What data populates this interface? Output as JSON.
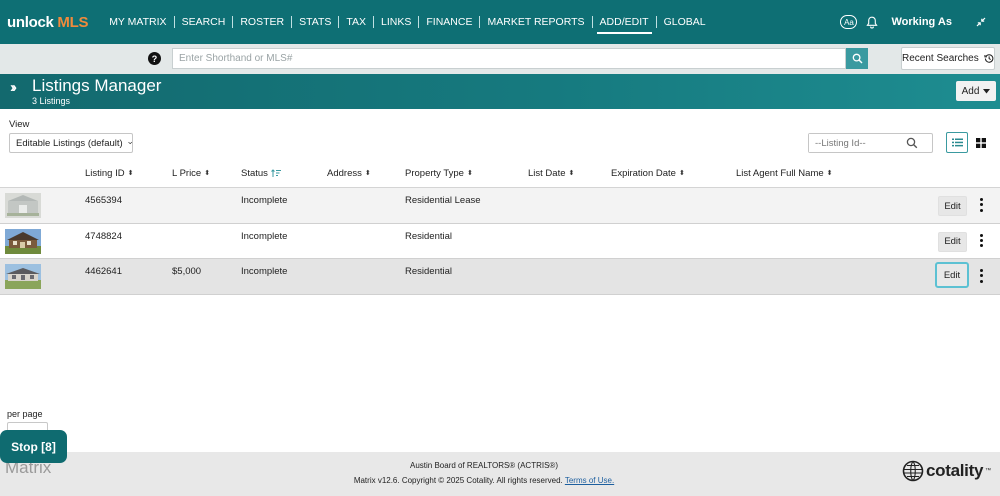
{
  "topnav": {
    "logo_primary": "unlock",
    "logo_accent": "MLS",
    "menu": [
      "MY MATRIX",
      "SEARCH",
      "ROSTER",
      "STATS",
      "TAX",
      "LINKS",
      "FINANCE",
      "MARKET REPORTS",
      "ADD/EDIT",
      "GLOBAL"
    ],
    "active_menu": "ADD/EDIT",
    "font_button": "Aa",
    "working_as": "Working As"
  },
  "searchbar": {
    "placeholder": "Enter Shorthand or MLS#",
    "recent_label": "Recent Searches"
  },
  "header": {
    "title": "Listings Manager",
    "subtitle": "3 Listings",
    "add_label": "Add"
  },
  "view": {
    "label": "View",
    "selected": "Editable Listings (default)",
    "listing_search_placeholder": "--Listing Id--"
  },
  "table": {
    "columns": [
      "Listing ID",
      "L Price",
      "Status",
      "Address",
      "Property Type",
      "List Date",
      "Expiration Date",
      "List Agent Full Name"
    ],
    "rows": [
      {
        "listing_id": "4565394",
        "price": "",
        "status": "Incomplete",
        "address": "",
        "property_type": "Residential Lease",
        "list_date": "",
        "expiration_date": "",
        "agent": "",
        "edit_label": "Edit"
      },
      {
        "listing_id": "4748824",
        "price": "",
        "status": "Incomplete",
        "address": "",
        "property_type": "Residential",
        "list_date": "",
        "expiration_date": "",
        "agent": "",
        "edit_label": "Edit"
      },
      {
        "listing_id": "4462641",
        "price": "$5,000",
        "status": "Incomplete",
        "address": "",
        "property_type": "Residential",
        "list_date": "",
        "expiration_date": "",
        "agent": "",
        "edit_label": "Edit"
      }
    ]
  },
  "pagination": {
    "per_page_label": "per page"
  },
  "stop_button": "Stop [8]",
  "footer": {
    "matrix_logo": "Matrix",
    "board": "Austin Board of REALTORS® (ACTRIS®)",
    "copyright": "Matrix v12.6. Copyright © 2025 Cotality. All rights reserved.",
    "terms_link": "Terms of Use.",
    "cotality_logo": "cotality",
    "cotality_tm": "™"
  },
  "colors": {
    "nav_bg": "#0e6f74",
    "accent_orange": "#f08a3c",
    "header_bg": "#167a7f",
    "focus_ring": "#5cc1d3"
  }
}
